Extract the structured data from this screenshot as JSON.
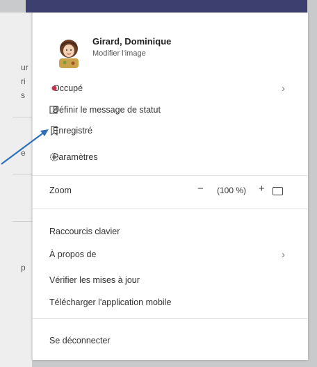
{
  "profile": {
    "name": "Girard, Dominique",
    "edit_image": "Modifier l'image"
  },
  "status": {
    "label": "Occupé",
    "color": "#c4314b"
  },
  "menu_items": [
    {
      "label": "Définir le message de statut",
      "icon": "edit-message-icon"
    },
    {
      "label": "Enregistré",
      "icon": "bookmark-icon"
    },
    {
      "label": "Paramètres",
      "icon": "gear-icon"
    }
  ],
  "zoom": {
    "label": "Zoom",
    "minus": "−",
    "value": "(100 %)",
    "plus": "+"
  },
  "links": [
    {
      "label": "Raccourcis clavier"
    },
    {
      "label": "À propos de"
    },
    {
      "label": "Vérifier les mises à jour"
    },
    {
      "label": "Télécharger l'application mobile"
    }
  ],
  "signout": "Se déconnecter",
  "background_fragments": [
    "ur",
    "ri",
    "s",
    "e",
    "p"
  ],
  "colors": {
    "topbar": "#3d3f6e",
    "arrow": "#2f6fb8"
  }
}
